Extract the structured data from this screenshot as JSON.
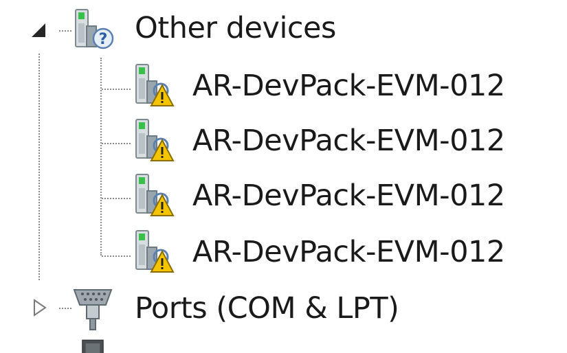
{
  "tree": {
    "other_devices": {
      "label": "Other devices",
      "expanded": true,
      "icon": "unknown-device-icon",
      "children": [
        {
          "label": "AR-DevPack-EVM-012",
          "icon": "device-warning-icon"
        },
        {
          "label": "AR-DevPack-EVM-012",
          "icon": "device-warning-icon"
        },
        {
          "label": "AR-DevPack-EVM-012",
          "icon": "device-warning-icon"
        },
        {
          "label": "AR-DevPack-EVM-012",
          "icon": "device-warning-icon"
        }
      ]
    },
    "ports": {
      "label": "Ports (COM & LPT)",
      "expanded": false,
      "icon": "port-connector-icon"
    },
    "next": {
      "label": "",
      "icon": "processor-icon"
    }
  },
  "colors": {
    "connector": "#8a8a8a",
    "warning_fill": "#f5c400",
    "text": "#1a1a1a"
  }
}
